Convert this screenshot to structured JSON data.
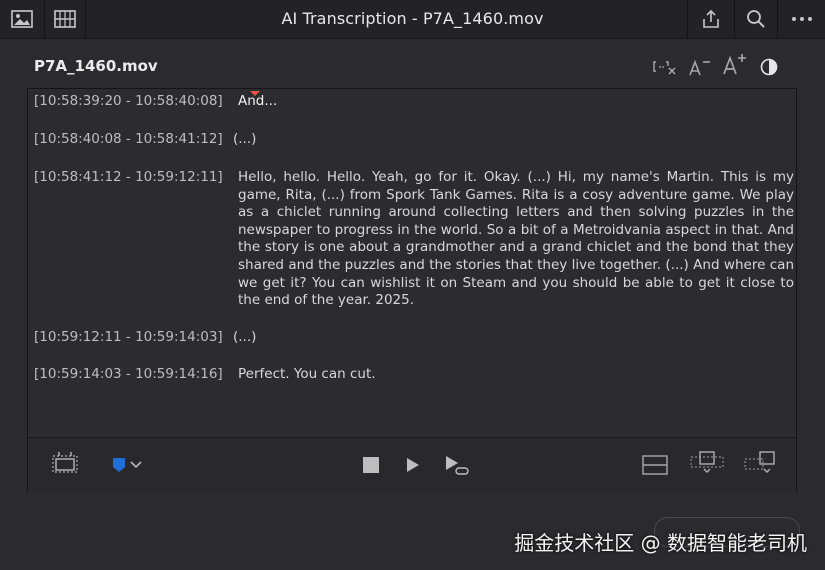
{
  "window": {
    "title": "AI Transcription - P7A_1460.mov"
  },
  "header": {
    "filename": "P7A_1460.mov"
  },
  "transcript": [
    {
      "timecode": "[10:58:39:20 - 10:58:40:08]",
      "text": "And..."
    },
    {
      "timecode": "[10:58:40:08 - 10:58:41:12]",
      "text": "(...)"
    },
    {
      "timecode": "[10:58:41:12 - 10:59:12:11]",
      "text": "Hello, hello. Hello. Yeah, go for it. Okay. (...) Hi, my name's Martin. This is my game, Rita, (...) from Spork Tank Games. Rita is a cosy adventure game. We play as a chiclet running around collecting letters and then solving puzzles in the newspaper to progress in the world. So a bit of a Metroidvania aspect in that. And the story is one about a grandmother and a grand chiclet and the bond that they shared and the puzzles and the stories that they live together. (...) And where can we get it? You can wishlist it on Steam and you should be able to get it close to the end of the year. 2025."
    },
    {
      "timecode": "[10:59:12:11 - 10:59:14:03]",
      "text": "(...)"
    },
    {
      "timecode": "[10:59:14:03 - 10:59:14:16]",
      "text": "Perfect. You can cut."
    }
  ],
  "watermark": "掘金技术社区 @ 数据智能老司机",
  "colors": {
    "accent_marker": "#1e6fd9",
    "playhead": "#e8544c"
  },
  "icons": {
    "titlebar_left": [
      "image-view-icon",
      "filmstrip-icon"
    ],
    "titlebar_right": [
      "share-icon",
      "search-icon",
      "more-icon"
    ],
    "toolbar": [
      "remove-silence-icon",
      "decrease-font-icon",
      "increase-font-icon",
      "contrast-icon"
    ],
    "bottom": [
      "create-subtitles-icon",
      "marker-icon",
      "stop-icon",
      "play-icon",
      "play-loop-icon",
      "insert-icon",
      "overwrite-icon",
      "append-icon"
    ]
  }
}
